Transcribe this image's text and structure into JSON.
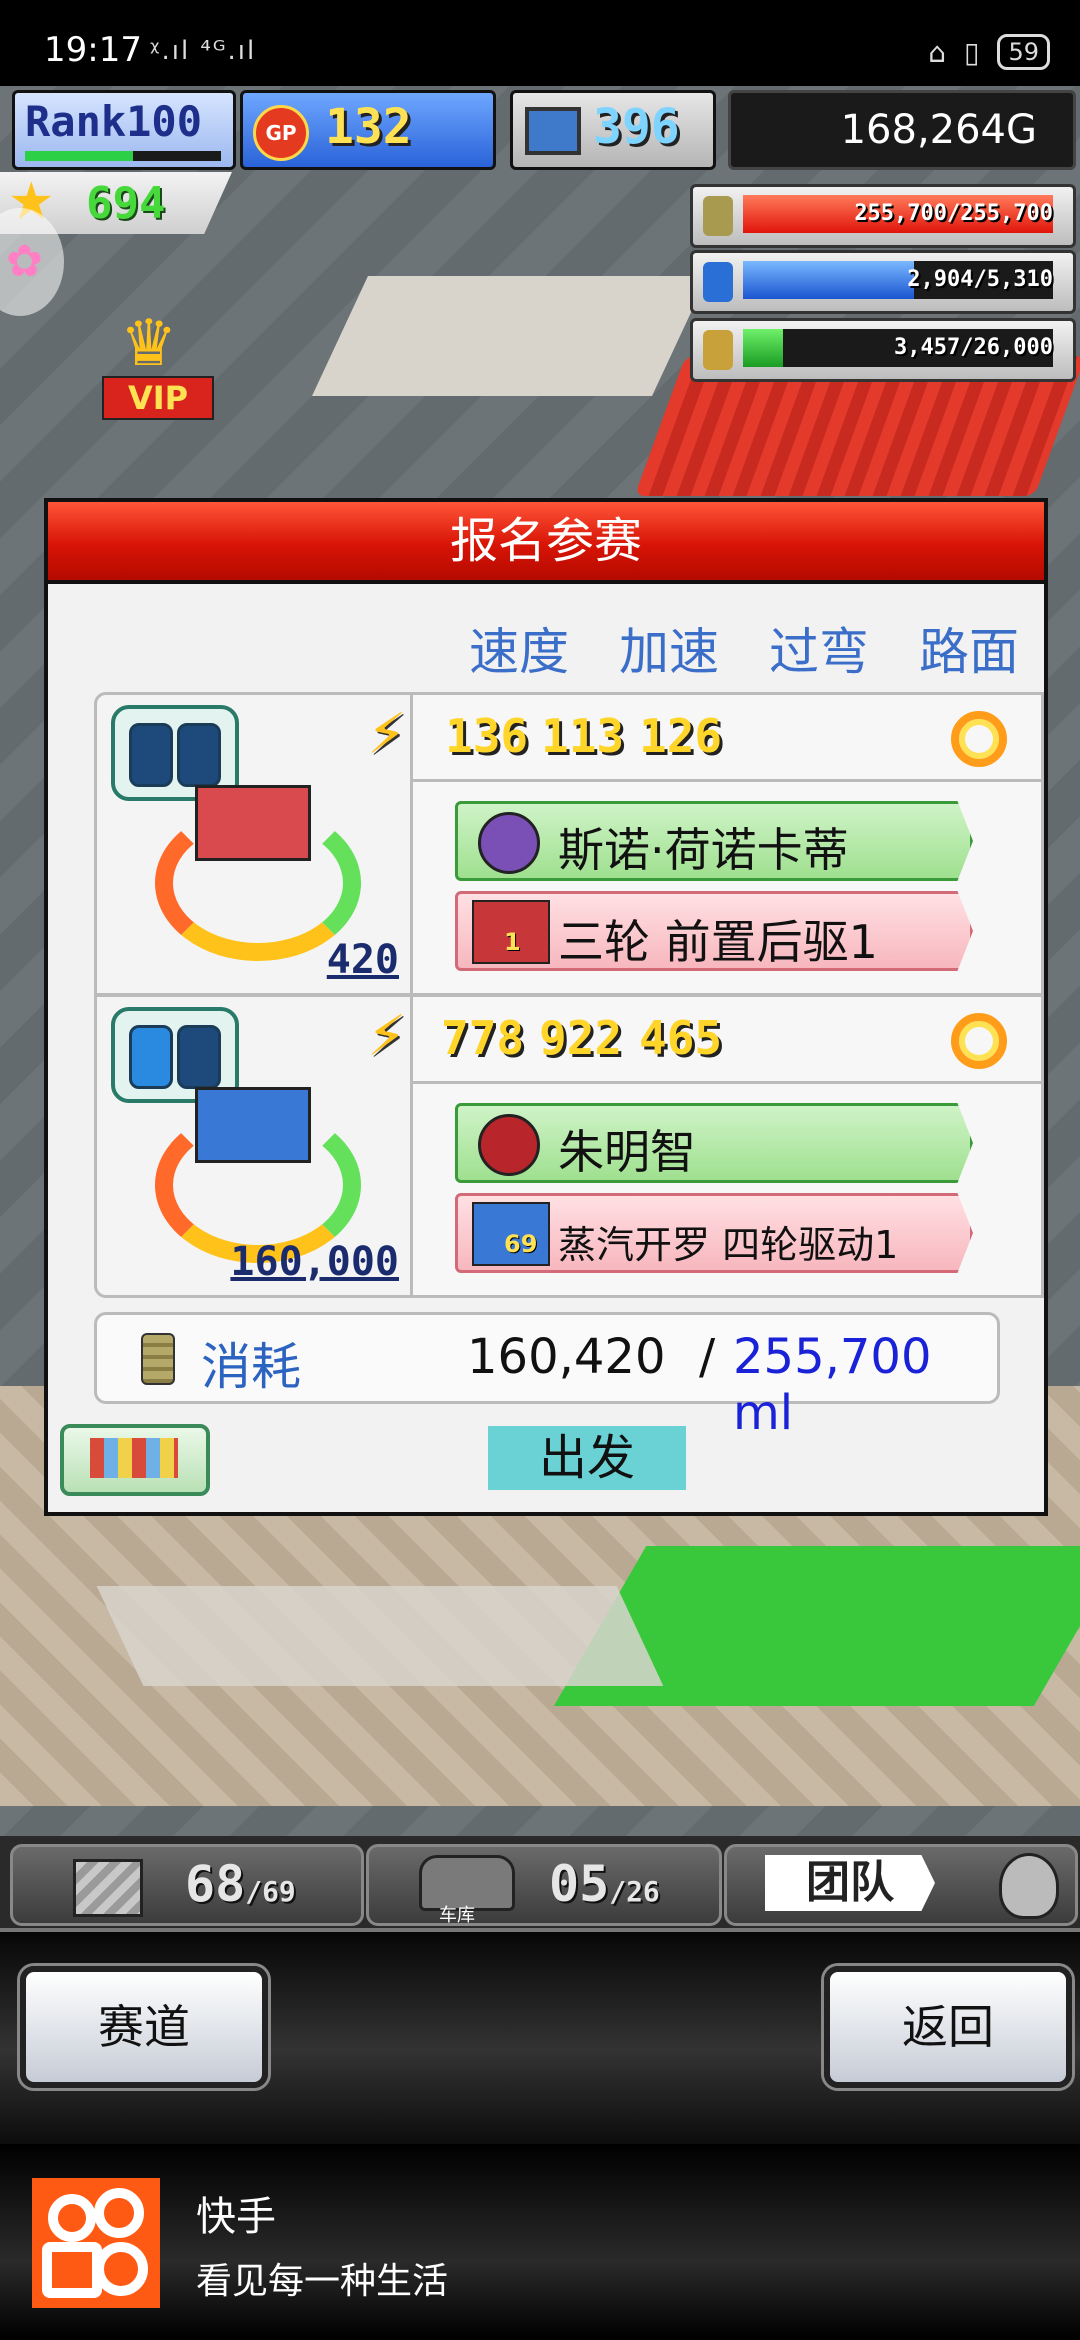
{
  "status_bar": {
    "time": "19:17",
    "signal": "ᵡ.ıl ⁴ᴳ.ıl",
    "battery": "59"
  },
  "hud": {
    "rank": "Rank100",
    "gp_label": "GP",
    "gp_value": "132",
    "research_value": "396",
    "money": "168,264G",
    "stars": "694",
    "fuel": "255,700/255,700",
    "fuel_fill": 1.0,
    "water": "2,904/5,310",
    "water_fill": 0.55,
    "wheat": "3,457/26,000",
    "wheat_fill": 0.13,
    "vip": "VIP"
  },
  "modal": {
    "title": "报名参赛",
    "col_heads": [
      "速度",
      "加速",
      "过弯",
      "路面"
    ],
    "slots": [
      {
        "stats": [
          "136",
          "113",
          "126"
        ],
        "power": "420",
        "driver": "斯诺·荷诺卡蒂",
        "vehicle": "三轮 前置后驱1",
        "vehicle_level": "1",
        "colors": {
          "car": "#d94a4f"
        }
      },
      {
        "stats": [
          "778",
          "922",
          "465"
        ],
        "power": "160,000",
        "driver": "朱明智",
        "vehicle": "蒸汽开罗 四轮驱动1",
        "vehicle_level": "69",
        "colors": {
          "car": "#3a78d6"
        }
      }
    ],
    "consume_label": "消耗",
    "consume_current": "160,420",
    "consume_sep": "/",
    "consume_max": "255,700 ml",
    "go_button": "出发"
  },
  "bottom_hud": {
    "parts": "68",
    "parts_max": "/69",
    "garage_caption": "车库",
    "garage": "05",
    "garage_max": "/26",
    "team": "团队"
  },
  "panel": {
    "left_button": "赛道",
    "right_button": "返回"
  },
  "ad": {
    "title": "快手",
    "subtitle": "看见每一种生活"
  }
}
